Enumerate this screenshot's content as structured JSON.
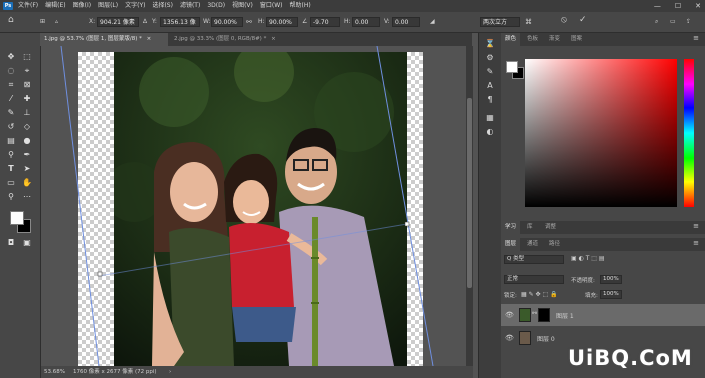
{
  "app": {
    "logo": "Ps"
  },
  "menu": [
    "文件(F)",
    "编辑(E)",
    "图像(I)",
    "图层(L)",
    "文字(Y)",
    "选择(S)",
    "滤镜(T)",
    "3D(D)",
    "视图(V)",
    "窗口(W)",
    "帮助(H)"
  ],
  "window_controls": {
    "minimize": "—",
    "maximize": "☐",
    "close": "✕"
  },
  "options": {
    "x_label": "X:",
    "x_value": "904.21 像素",
    "y_label": "Y:",
    "y_value": "1356.13 像",
    "w_label": "W:",
    "w_value": "90.00%",
    "h_label": "H:",
    "h_value": "90.00%",
    "angle_value": "-9.70",
    "hskew_label": "H:",
    "hskew_value": "0.00",
    "vskew_label": "V:",
    "vskew_value": "0.00",
    "interp_value": "两次立方",
    "cancel_icon": "⦸",
    "commit_icon": "✓"
  },
  "tabs": [
    {
      "label": "1.jpg @ 53.7% (图层 1, 图层蒙版/8) *",
      "close": "×"
    },
    {
      "label": "2.jpg @ 33.3% (图层 0, RGB/8#) *",
      "close": "×"
    }
  ],
  "status": {
    "zoom": "53.68%",
    "doc_info": "1760 像素 x 2677 像素 (72 ppi)"
  },
  "color_panel": {
    "tabs": [
      "颜色",
      "色板",
      "渐变",
      "图案"
    ],
    "accent": "#ff0000"
  },
  "learn_panel": {
    "tabs": [
      "学习",
      "库",
      "调整"
    ]
  },
  "layers_panel": {
    "tabs": [
      "图层",
      "通道",
      "路径"
    ],
    "kind_placeholder": "Q 类型",
    "blend_mode": "正常",
    "opacity_label": "不透明度:",
    "opacity_value": "100%",
    "lock_label": "锁定:",
    "fill_label": "填充:",
    "fill_value": "100%",
    "layers": [
      {
        "name": "图层 1",
        "selected": true
      },
      {
        "name": "图层 0",
        "selected": false
      }
    ]
  },
  "watermark": "UiBQ.CoM"
}
